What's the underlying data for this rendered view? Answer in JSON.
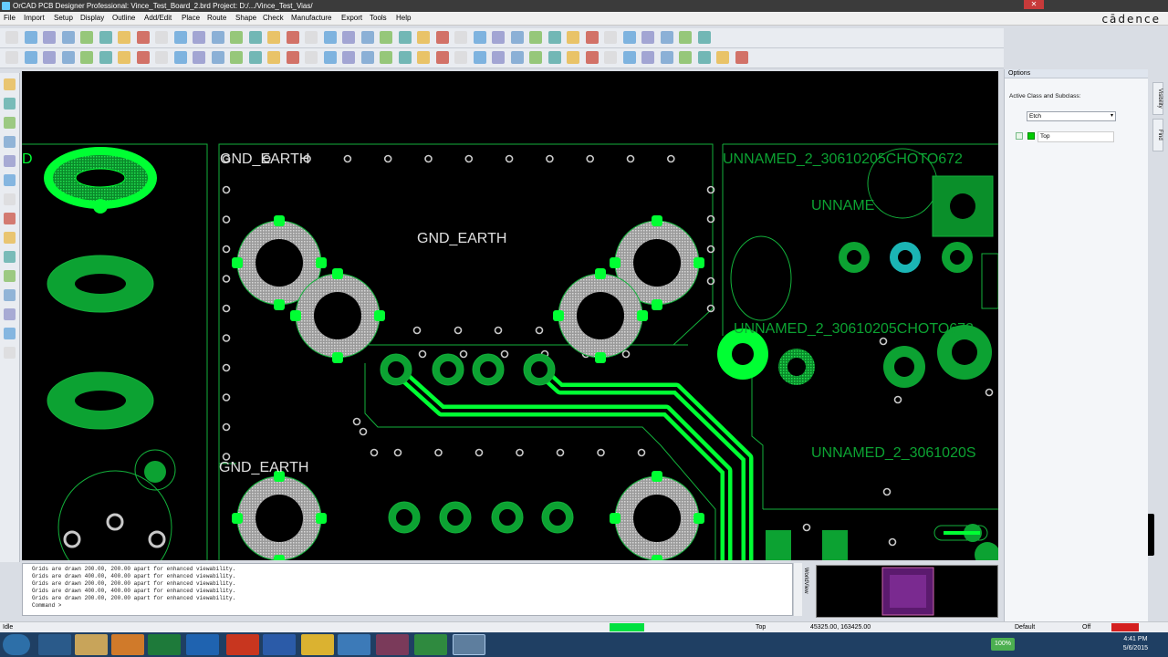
{
  "window": {
    "title": "OrCAD PCB Designer Professional: Vince_Test_Board_2.brd  Project: D:/.../Vince_Test_Vias/"
  },
  "brand": "cādence",
  "menu": [
    "File",
    "Import",
    "Setup",
    "Display",
    "Outline",
    "Add/Edit",
    "Place",
    "Route",
    "Shape",
    "Check",
    "Manufacture",
    "Export",
    "Tools",
    "Help"
  ],
  "canvas": {
    "labels": {
      "gnd_earth_1": "GND_EARTH",
      "gnd_earth_2": "GND_EARTH",
      "gnd_earth_3": "GND_EARTH",
      "unnamed_1": "UNNAMED_2_30610205CHOTO672",
      "unnamed_2": "UNNAME",
      "unnamed_3": "UNNAMED_2_30610205CHOTO672",
      "unnamed_4": "UNNAMED_2_3061020S",
      "left_d": "D"
    }
  },
  "options": {
    "header": "Options",
    "active_class_label": "Active Class and Subclass:",
    "class_value": "Etch",
    "subclass_value": "Top"
  },
  "side_tabs": [
    "Visibility",
    "Find"
  ],
  "console": {
    "lines": [
      "Grids are drawn 200.00, 200.00 apart for enhanced viewability.",
      "Grids are drawn 400.00, 400.00 apart for enhanced viewability.",
      "Grids are drawn 200.00, 200.00 apart for enhanced viewability.",
      "Grids are drawn 400.00, 400.00 apart for enhanced viewability.",
      "Grids are drawn 200.00, 200.00 apart for enhanced viewability.",
      "Command >"
    ]
  },
  "worldview_label": "WorldView",
  "status": {
    "state": "Idle",
    "layer": "Top",
    "coords": "45325.00, 163425.00",
    "mode": "Default",
    "off": "Off"
  },
  "taskbar": {
    "time": "4:41 PM",
    "date": "5/6/2015",
    "battery": "100%"
  },
  "colors": {
    "canvas_bg": "#000000",
    "etch_green": "#00ff33",
    "outline_green": "#13b13b",
    "pad_gray": "#c9c9c9",
    "taskbar": "#1f3f63"
  }
}
